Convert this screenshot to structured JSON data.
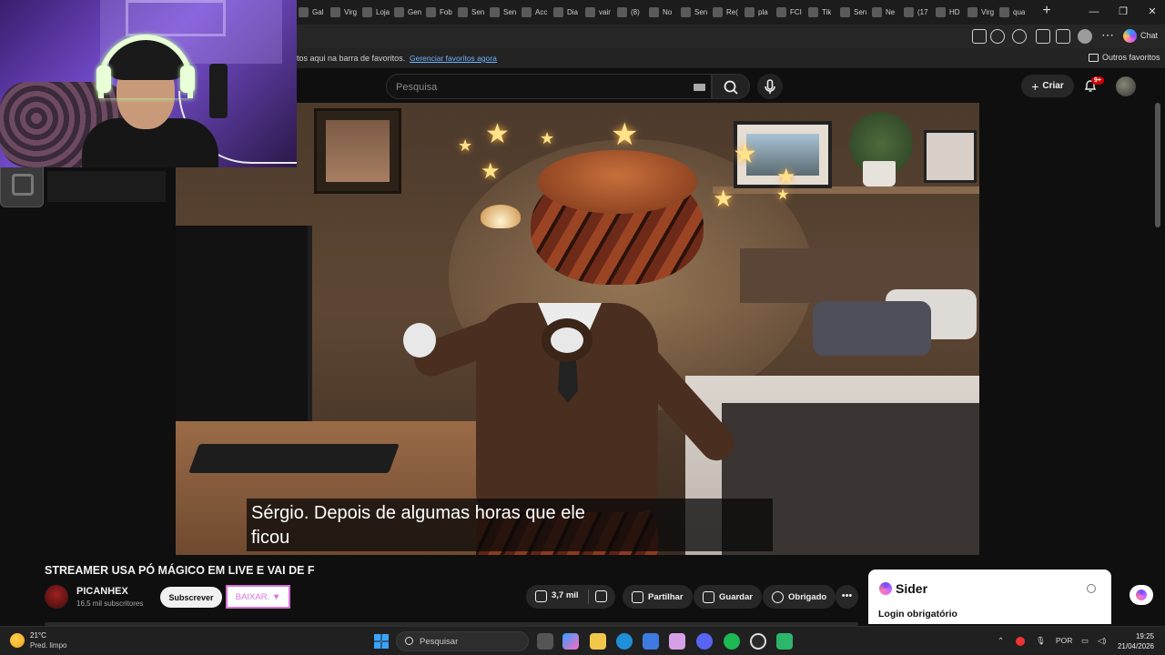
{
  "browser": {
    "tabs": [
      {
        "label": "Gal",
        "x": 0
      },
      {
        "label": "Virg",
        "x": 0
      },
      {
        "label": "Loja",
        "x": 0
      },
      {
        "label": "Gen",
        "x": 0
      },
      {
        "label": "Fob",
        "x": 0
      },
      {
        "label": "Sen",
        "x": 0
      },
      {
        "label": "Sen",
        "x": 0
      },
      {
        "label": "Acc",
        "x": 0
      },
      {
        "label": "Dia",
        "x": 0
      },
      {
        "label": "vair",
        "x": 0
      },
      {
        "label": "(8)",
        "x": 0
      },
      {
        "label": "No",
        "x": 0
      },
      {
        "label": "Sen",
        "x": 0
      },
      {
        "label": "Re(",
        "x": 0
      },
      {
        "label": "pla",
        "x": 0
      },
      {
        "label": "FCI",
        "x": 0
      },
      {
        "label": "Tik",
        "x": 0
      },
      {
        "label": "Sen",
        "x": 0
      },
      {
        "label": "Ne",
        "x": 0
      },
      {
        "label": "(17",
        "x": 0
      },
      {
        "label": "HD",
        "x": 0
      },
      {
        "label": "Virg",
        "x": 0
      },
      {
        "label": "qua",
        "x": 0
      }
    ],
    "chat_label": "Chat",
    "bookmarks_hint": "tos aqui na barra de favoritos.",
    "bookmarks_link": "Gerenciar favoritos agora",
    "bookmarks_folder": "Outros favoritos"
  },
  "youtube": {
    "search_placeholder": "Pesquisa",
    "create_label": "Criar",
    "notif_badge": "9+"
  },
  "video": {
    "caption_line1": "Sérgio. Depois de algumas horas que ele",
    "caption_line2": "ficou",
    "title": "STREAMER USA PÓ MÁGICO EM LIVE E VAI DE F",
    "channel_name": "PICANHEX",
    "channel_subs": "16,5 mil subscritores",
    "subscribe_label": "Subscrever",
    "download_label": "BAIXAR. ▼",
    "likes": "3,7 mil",
    "share_label": "Partilhar",
    "save_label": "Guardar",
    "thanks_label": "Obrigado",
    "more_label": "•••"
  },
  "sider": {
    "name": "Sider",
    "login": "Login obrigatório"
  },
  "taskbar": {
    "temp": "21°C",
    "weather": "Pred. limpo",
    "search": "Pesquisar",
    "lang": "POR",
    "time": "19:25",
    "date": "21/04/2026"
  }
}
